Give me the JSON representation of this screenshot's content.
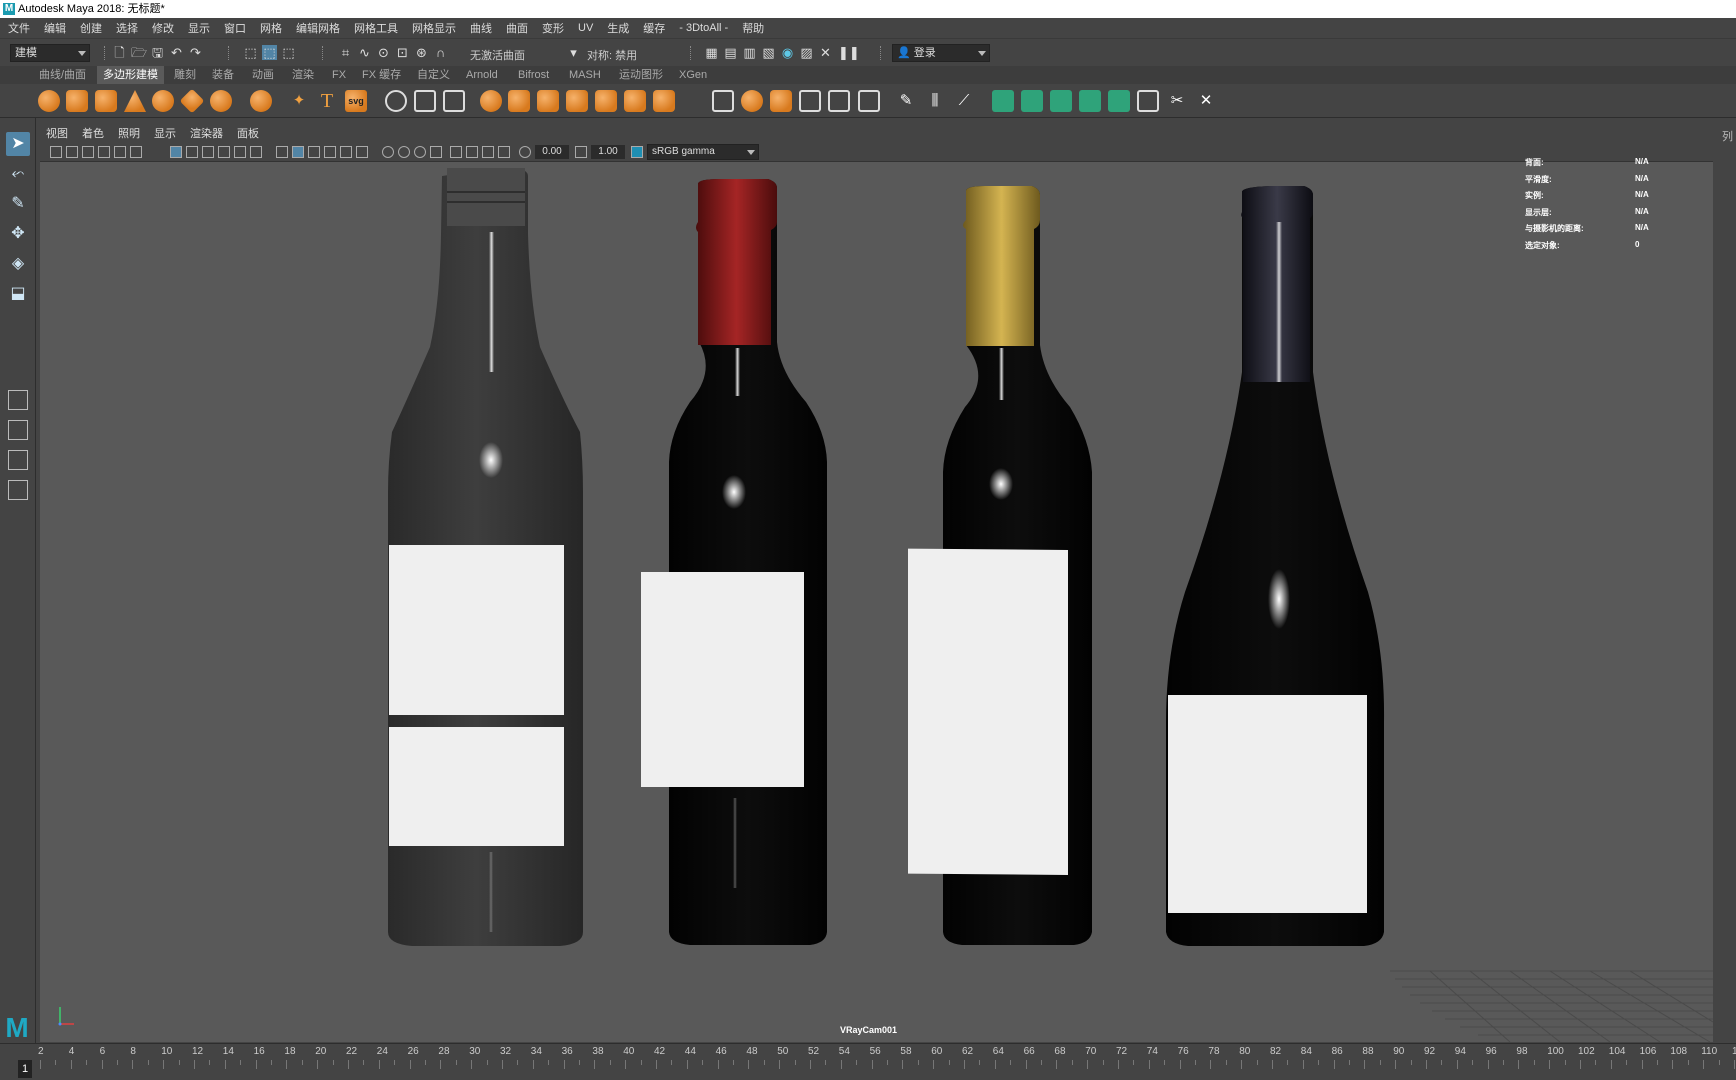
{
  "window": {
    "title": "Autodesk Maya 2018: 无标题*"
  },
  "menubar": [
    "文件",
    "编辑",
    "创建",
    "选择",
    "修改",
    "显示",
    "窗口",
    "网格",
    "编辑网格",
    "网格工具",
    "网格显示",
    "曲线",
    "曲面",
    "变形",
    "UV",
    "生成",
    "缓存",
    "- 3DtoAll -",
    "帮助"
  ],
  "statusline": {
    "mode": "建模",
    "live_surface": "无激活曲面",
    "symmetry": "对称: 禁用",
    "login": "登录"
  },
  "shelf_tabs": [
    "曲线/曲面",
    "多边形建模",
    "雕刻",
    "装备",
    "动画",
    "渲染",
    "FX",
    "FX 缓存",
    "自定义",
    "Arnold",
    "Bifrost",
    "MASH",
    "运动图形",
    "XGen"
  ],
  "shelf_active_tab": "多边形建模",
  "shelf_icons": [
    "poly-sphere-icon",
    "poly-cube-icon",
    "poly-cylinder-icon",
    "poly-cone-icon",
    "poly-torus-icon",
    "poly-plane-icon",
    "poly-disc-icon",
    "platonic-icon",
    "sweep-icon",
    "type-icon",
    "svg-icon"
  ],
  "shelf_svg_label": "svg",
  "shelf_type_label": "T",
  "viewport": {
    "menu": [
      "视图",
      "着色",
      "照明",
      "显示",
      "渲染器",
      "面板"
    ],
    "exposure": "0.00",
    "gamma": "1.00",
    "color_space": "sRGB gamma",
    "camera": "VRayCam001"
  },
  "hud": [
    {
      "key": "背面:",
      "value": "N/A"
    },
    {
      "key": "平滑度:",
      "value": "N/A"
    },
    {
      "key": "实例:",
      "value": "N/A"
    },
    {
      "key": "显示层:",
      "value": "N/A"
    },
    {
      "key": "与摄影机的距离:",
      "value": "N/A"
    },
    {
      "key": "选定对象:",
      "value": "0"
    }
  ],
  "right_panel_label": "列",
  "timeline": {
    "current_frame": "1",
    "ticks": [
      "2",
      "4",
      "6",
      "8",
      "10",
      "12",
      "14",
      "16",
      "18",
      "20",
      "22",
      "24",
      "26",
      "28",
      "30",
      "32",
      "34",
      "36",
      "38",
      "40",
      "42",
      "44",
      "46",
      "48",
      "50",
      "52",
      "54",
      "56",
      "58",
      "60",
      "62",
      "64",
      "66",
      "68",
      "70",
      "72",
      "74",
      "76",
      "78",
      "80",
      "82",
      "84",
      "86",
      "88",
      "90",
      "92",
      "94",
      "96",
      "98",
      "100",
      "102",
      "104",
      "106",
      "108",
      "110",
      "1"
    ]
  },
  "colors": {
    "bottle_grey": "#3a3a3a",
    "capsule_red": "#8a1c1c",
    "capsule_gold": "#b89a3a",
    "capsule_black": "#15151c",
    "viewport_bg": "#595959"
  }
}
